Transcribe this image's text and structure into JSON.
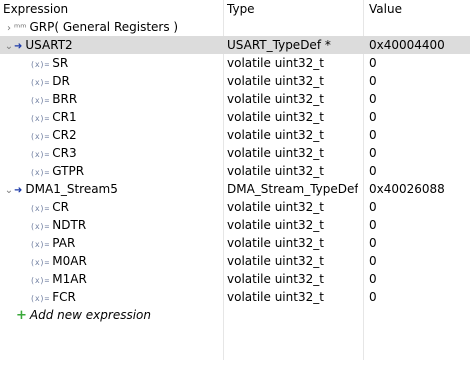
{
  "header": {
    "expression": "Expression",
    "type": "Type",
    "value": "Value"
  },
  "rows": [
    {
      "expr": "GRP( General Registers )",
      "type": "",
      "value": ""
    },
    {
      "expr": "USART2",
      "type": "USART_TypeDef *",
      "value": "0x40004400"
    },
    {
      "expr": "SR",
      "type": "volatile uint32_t",
      "value": "0"
    },
    {
      "expr": "DR",
      "type": "volatile uint32_t",
      "value": "0"
    },
    {
      "expr": "BRR",
      "type": "volatile uint32_t",
      "value": "0"
    },
    {
      "expr": "CR1",
      "type": "volatile uint32_t",
      "value": "0"
    },
    {
      "expr": "CR2",
      "type": "volatile uint32_t",
      "value": "0"
    },
    {
      "expr": "CR3",
      "type": "volatile uint32_t",
      "value": "0"
    },
    {
      "expr": "GTPR",
      "type": "volatile uint32_t",
      "value": "0"
    },
    {
      "expr": "DMA1_Stream5",
      "type": "DMA_Stream_TypeDef *",
      "value": "0x40026088"
    },
    {
      "expr": "CR",
      "type": "volatile uint32_t",
      "value": "0"
    },
    {
      "expr": "NDTR",
      "type": "volatile uint32_t",
      "value": "0"
    },
    {
      "expr": "PAR",
      "type": "volatile uint32_t",
      "value": "0"
    },
    {
      "expr": "M0AR",
      "type": "volatile uint32_t",
      "value": "0"
    },
    {
      "expr": "M1AR",
      "type": "volatile uint32_t",
      "value": "0"
    },
    {
      "expr": "FCR",
      "type": "volatile uint32_t",
      "value": "0"
    }
  ],
  "add_expression": "Add new expression",
  "icons": {
    "collapsed": "chevron-right-icon",
    "expanded": "chevron-down-icon",
    "register_group": "register-group-icon",
    "pointer": "pointer-icon",
    "field": "field-icon",
    "add": "add-icon"
  },
  "colors": {
    "selected_row": "#dcdcdc",
    "add_icon": "#3aa83a"
  }
}
